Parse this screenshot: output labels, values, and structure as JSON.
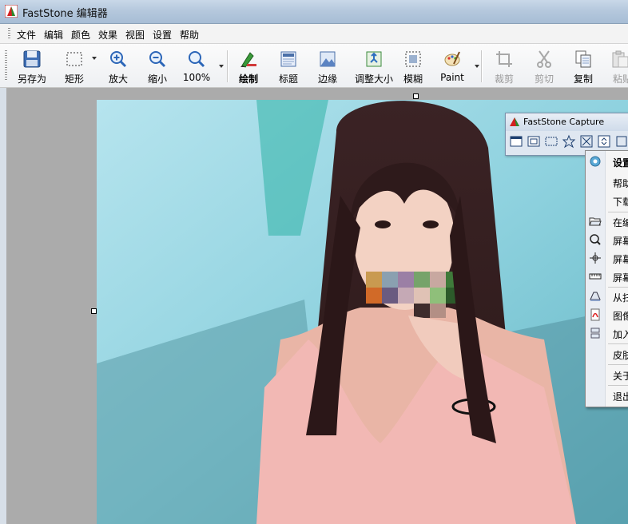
{
  "window": {
    "title": "FastStone 编辑器"
  },
  "menu": [
    "文件",
    "编辑",
    "颜色",
    "效果",
    "视图",
    "设置",
    "帮助"
  ],
  "toolbar": {
    "save_as": "另存为",
    "rectangle": "矩形",
    "zoom_in": "放大",
    "zoom_out": "缩小",
    "zoom_level": "100%",
    "draw": "绘制",
    "caption": "标题",
    "edge": "边缘",
    "resize": "调整大小",
    "blur": "模糊",
    "paint": "Paint",
    "crop": "裁剪",
    "cut": "剪切",
    "copy": "复制",
    "paste": "粘贴"
  },
  "capture_panel": {
    "title": "FastStone Capture"
  },
  "capture_menu": [
    "设置",
    "帮助",
    "下载",
    "在编",
    "屏幕",
    "屏幕",
    "屏幕",
    "从扫",
    "图像",
    "加入",
    "皮肤",
    "关于",
    "退出"
  ],
  "colors": {
    "accent": "#1a64c8",
    "titlebar": "#b5c8dd",
    "workspace": "#ababab",
    "menu_bg": "#f5f5f5"
  }
}
